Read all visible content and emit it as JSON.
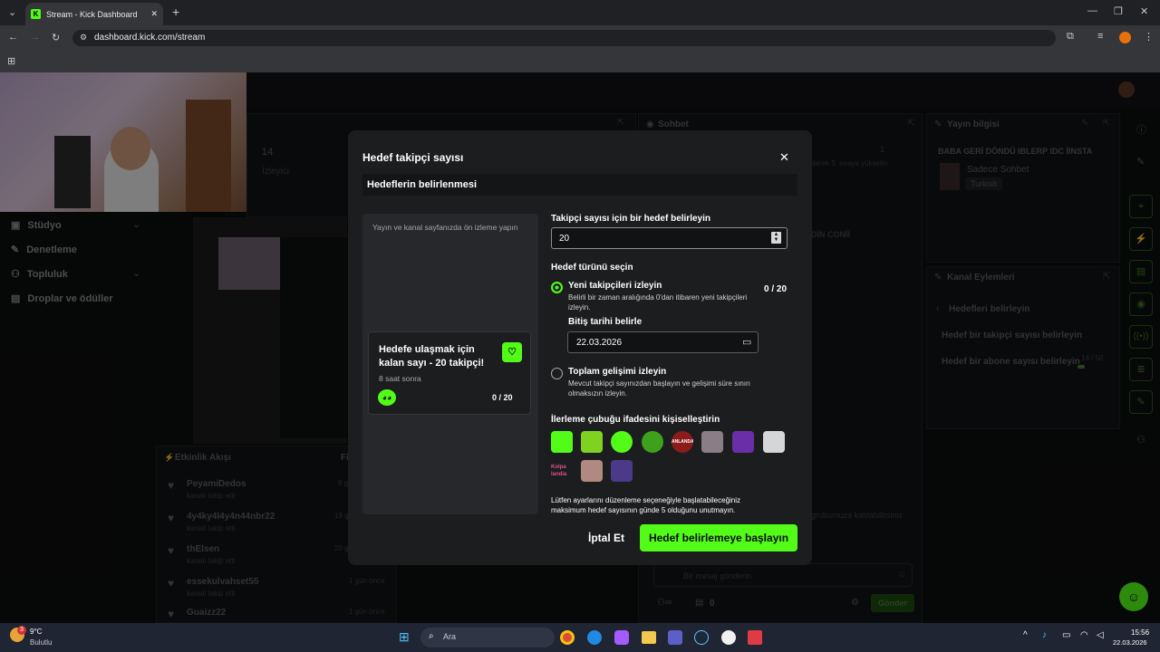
{
  "browser": {
    "tab_title": "Stream - Kick Dashboard",
    "url": "dashboard.kick.com/stream"
  },
  "sidebar": {
    "items": [
      {
        "label": "Stüdyo"
      },
      {
        "label": "Denetleme"
      },
      {
        "label": "Topluluk"
      },
      {
        "label": "Droplar ve ödüller"
      }
    ]
  },
  "background": {
    "viewers_count": "14",
    "viewers_label": "İzleyici",
    "chat_title": "Sohbet",
    "chat_snippet": "derek 3. sıraya yükselin",
    "chat_name": "DİN CONİİ",
    "chat_count": "1",
    "stream_info_title": "Yayın bilgisi",
    "stream_title": "BABA GERİ DÖNDÜ IBLERP IDC İINSTA",
    "category": "Sadece Sohbet",
    "language": "Turkish",
    "channel_actions_title": "Kanal Eylemleri",
    "goals_back": "Hedefleri belirleyin",
    "goal_followers": "Hedef bir takipçi sayısı belirleyin",
    "goal_subs": "Hedef bir abone sayısı belirleyin",
    "sub_progress": "14 / 50",
    "join_text": "grubumuza katılabilirsiniz",
    "chat_placeholder": "Bir mesaj gönderin",
    "send_label": "Gönder",
    "bottom_count": "0",
    "activity_title": "Etkinlik Akışı",
    "activity_filter": "Fi",
    "activity": [
      {
        "name": "PeyamiDedos",
        "sub": "kanalı takip etti",
        "time": "8 gü"
      },
      {
        "name": "4y4ky4l4y4n44nbr22",
        "sub": "kanalı takip etti",
        "time": "19 gü"
      },
      {
        "name": "thElsen",
        "sub": "kanalı takip etti",
        "time": "20 gü"
      },
      {
        "name": "essekulvahset55",
        "sub": "kanalı takip etti",
        "time": "1 gün önce"
      },
      {
        "name": "Guaizz22",
        "sub": "",
        "time": "1 gün önce"
      }
    ]
  },
  "modal": {
    "title": "Hedef takipçi sayısı",
    "section_title": "Hedeflerin belirlenmesi",
    "preview_hint": "Yayın ve kanal sayfanızda ön izleme yapın",
    "preview_card": {
      "title": "Hedefe ulaşmak için kalan sayı - 20 takipçi!",
      "time": "8 saat sonra",
      "progress": "0 / 20"
    },
    "target_label": "Takipçi sayısı için bir hedef belirleyin",
    "target_value": "20",
    "type_label": "Hedef türünü seçin",
    "option1": {
      "title": "Yeni takipçileri izleyin",
      "desc": "Belirli bir zaman aralığında 0'dan itibaren yeni takipçileri izleyin.",
      "progress": "0 / 20"
    },
    "end_date_label": "Bitiş tarihi belirle",
    "end_date_value": "22.03.2026",
    "option2": {
      "title": "Toplam gelişimi izleyin",
      "desc": "Mevcut takipçi sayınızdan başlayın ve gelişimi süre sınırı olmaksızın izleyin."
    },
    "emote_label": "İlerleme çubuğu ifadesini kişiselleştirin",
    "emote_text_1": "ANLANDA",
    "emote_text_2": "Kolpa landia",
    "note": "Lütfen ayarlarını düzenleme seçeneğiyle başlatabileceğiniz maksimum hedef sayısının günde 5 olduğunu unutmayın.",
    "cancel_label": "İptal Et",
    "submit_label": "Hedef belirlemeye başlayın"
  },
  "taskbar": {
    "weather_temp": "9°C",
    "weather_desc": "Bulutlu",
    "search_placeholder": "Ara",
    "time": "15:56",
    "date": "22.03.2026",
    "notif_count": "3"
  },
  "colors": {
    "accent": "#53fc18",
    "modal_bg": "#1c1d1f"
  }
}
